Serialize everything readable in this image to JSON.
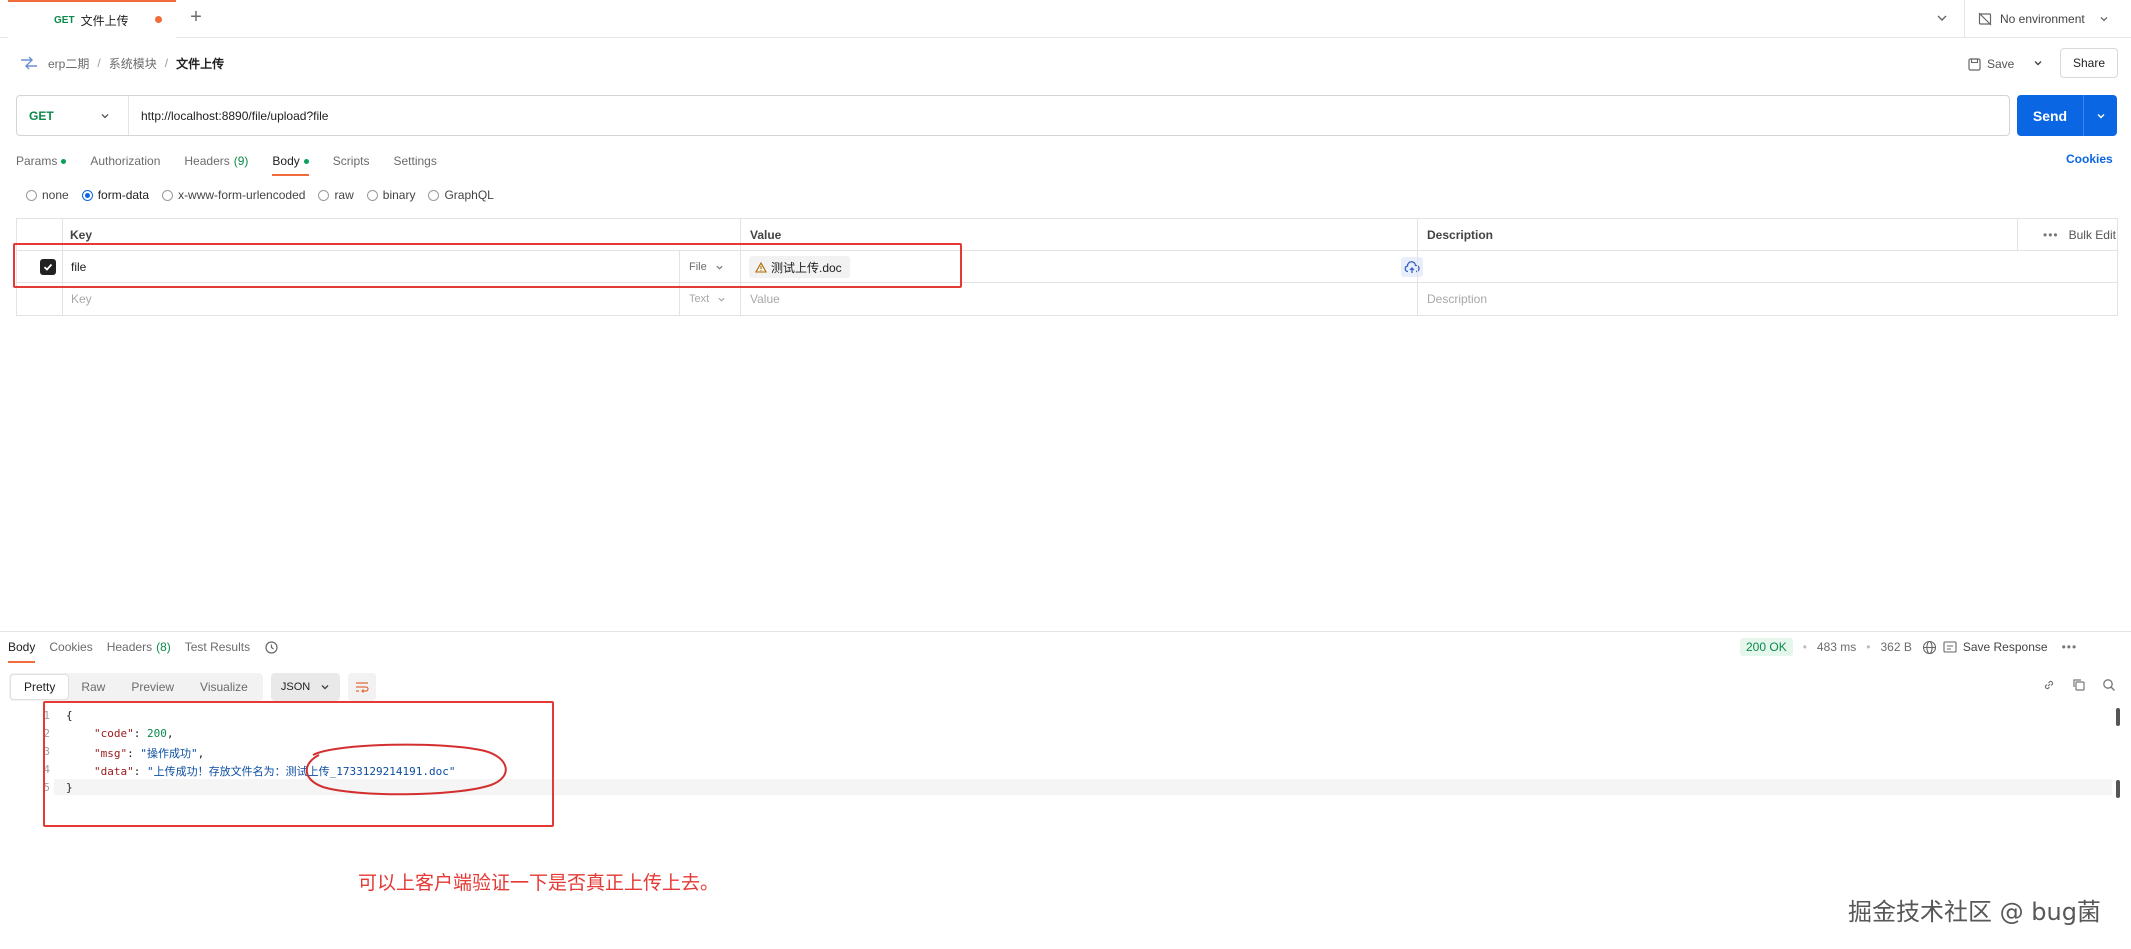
{
  "tab": {
    "method": "GET",
    "name": "文件上传"
  },
  "environment": {
    "label": "No environment"
  },
  "breadcrumb": {
    "workspace": "erp二期",
    "folder": "系统模块",
    "request": "文件上传"
  },
  "toolbar": {
    "save_label": "Save",
    "share_label": "Share"
  },
  "request": {
    "method": "GET",
    "url": "http://localhost:8890/file/upload?file",
    "send_label": "Send"
  },
  "request_tabs": [
    {
      "label": "Params",
      "dot": true
    },
    {
      "label": "Authorization"
    },
    {
      "label": "Headers",
      "count": "(9)"
    },
    {
      "label": "Body",
      "dot": true,
      "active": true
    },
    {
      "label": "Scripts"
    },
    {
      "label": "Settings"
    }
  ],
  "cookies_label": "Cookies",
  "body_types": [
    "none",
    "form-data",
    "x-www-form-urlencoded",
    "raw",
    "binary",
    "GraphQL"
  ],
  "body_selected": "form-data",
  "table": {
    "headers": {
      "key": "Key",
      "value": "Value",
      "description": "Description",
      "bulk_edit": "Bulk Edit"
    },
    "rows": [
      {
        "checked": true,
        "key": "file",
        "type": "File",
        "value": "测试上传.doc",
        "description": ""
      }
    ],
    "placeholder": {
      "key": "Key",
      "type": "Text",
      "value": "Value",
      "description": "Description"
    }
  },
  "response": {
    "tabs": [
      {
        "label": "Body",
        "active": true
      },
      {
        "label": "Cookies"
      },
      {
        "label": "Headers",
        "count": "(8)"
      },
      {
        "label": "Test Results"
      }
    ],
    "status": "200 OK",
    "time": "483 ms",
    "size": "362 B",
    "save_label": "Save Response",
    "views": [
      "Pretty",
      "Raw",
      "Preview",
      "Visualize"
    ],
    "view_selected": "Pretty",
    "format": "JSON",
    "line_numbers": [
      "1",
      "2",
      "3",
      "4",
      "5"
    ],
    "json": {
      "open": "{",
      "code_key": "\"code\"",
      "code_val": "200",
      "msg_key": "\"msg\"",
      "msg_val": "\"操作成功\"",
      "data_key": "\"data\"",
      "data_val": "\"上传成功！存放文件名为：测试上传_1733129214191.doc\"",
      "close": "}"
    }
  },
  "annotation": {
    "note": "可以上客户端验证一下是否真正上传上去。"
  },
  "watermark": "掘金技术社区 @ bug菌",
  "colors": {
    "accent": "#f26b3a",
    "send": "#0b66e4",
    "get": "#0a8a4a",
    "annotation": "#e53935"
  }
}
